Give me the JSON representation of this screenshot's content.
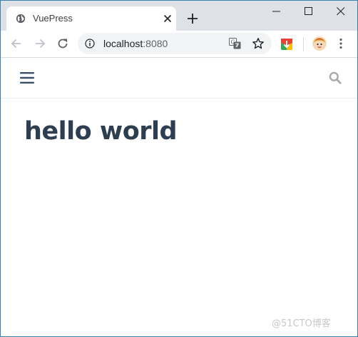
{
  "browser": {
    "tab": {
      "title": "VuePress",
      "favicon": "globe-icon"
    },
    "window_controls": [
      "minimize-icon",
      "maximize-icon",
      "close-icon"
    ],
    "toolbar": {
      "url_host": "localhost",
      "url_port": ":8080",
      "icons": [
        "back-arrow-icon",
        "forward-arrow-icon",
        "reload-icon",
        "info-icon",
        "translate-icon",
        "star-icon",
        "extension-icon",
        "avatar",
        "more-menu-icon"
      ]
    }
  },
  "page": {
    "navbar": {
      "menu_icon": "hamburger-icon",
      "search_icon": "search-icon"
    },
    "heading": "hello world"
  },
  "watermark": "@51CTO博客",
  "colors": {
    "tab_strip": "#dee1e6",
    "heading": "#2c3e50",
    "nav_icon": "#3a5169",
    "search_icon": "#aaaaaa",
    "window_border": "#3c7fb1"
  }
}
